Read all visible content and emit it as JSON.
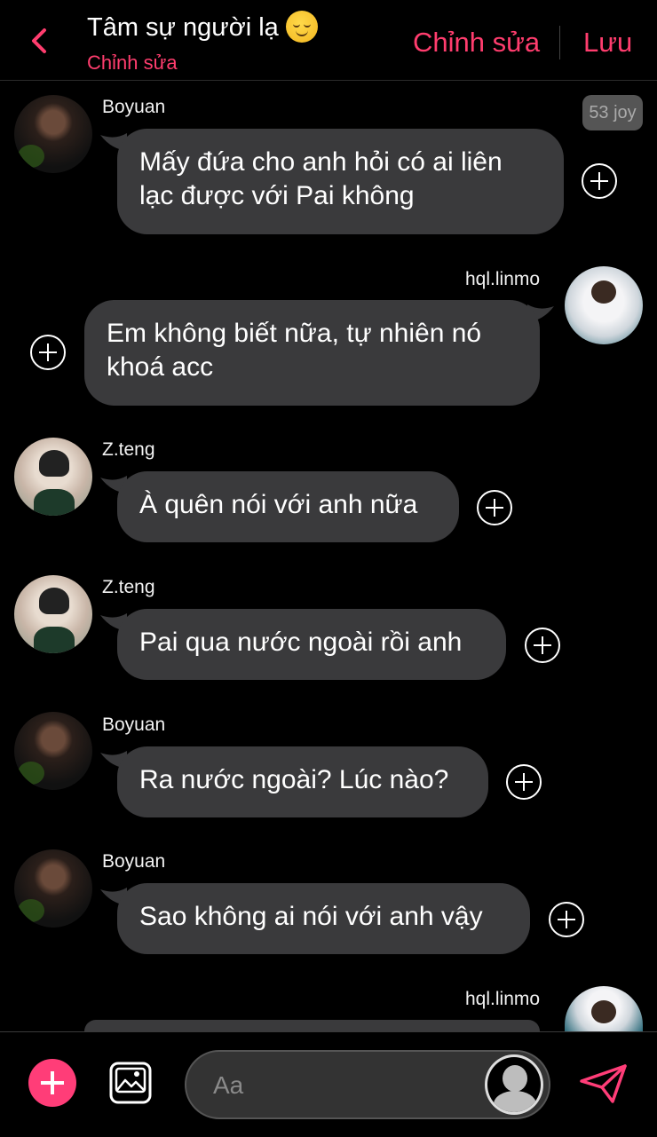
{
  "header": {
    "title": "Tâm sự người lạ",
    "title_emoji": "relieved-face-emoji",
    "subtitle": "Chỉnh sửa",
    "edit_label": "Chỉnh sửa",
    "save_label": "Lưu"
  },
  "accent_color": "#ff3d6e",
  "joy_badge": "53 joy",
  "messages": [
    {
      "sender": "Boyuan",
      "side": "left",
      "text": "Mấy đứa cho anh hỏi có ai liên lạc được với Pai không"
    },
    {
      "sender": "hql.linmo",
      "side": "right",
      "text": "Em không biết nữa, tự nhiên nó khoá acc"
    },
    {
      "sender": "Z.teng",
      "side": "left",
      "text": "À quên nói với anh nữa"
    },
    {
      "sender": "Z.teng",
      "side": "left",
      "text": "Pai qua nước ngoài rồi anh"
    },
    {
      "sender": "Boyuan",
      "side": "left",
      "text": "Ra nước ngoài? Lúc nào?"
    },
    {
      "sender": "Boyuan",
      "side": "left",
      "text": "Sao không ai nói với anh vậy"
    },
    {
      "sender": "hql.linmo",
      "side": "right",
      "text": ""
    }
  ],
  "composer": {
    "placeholder": "Aa",
    "icons": [
      "add-icon",
      "image-icon",
      "persona-avatar-icon",
      "send-icon"
    ]
  }
}
